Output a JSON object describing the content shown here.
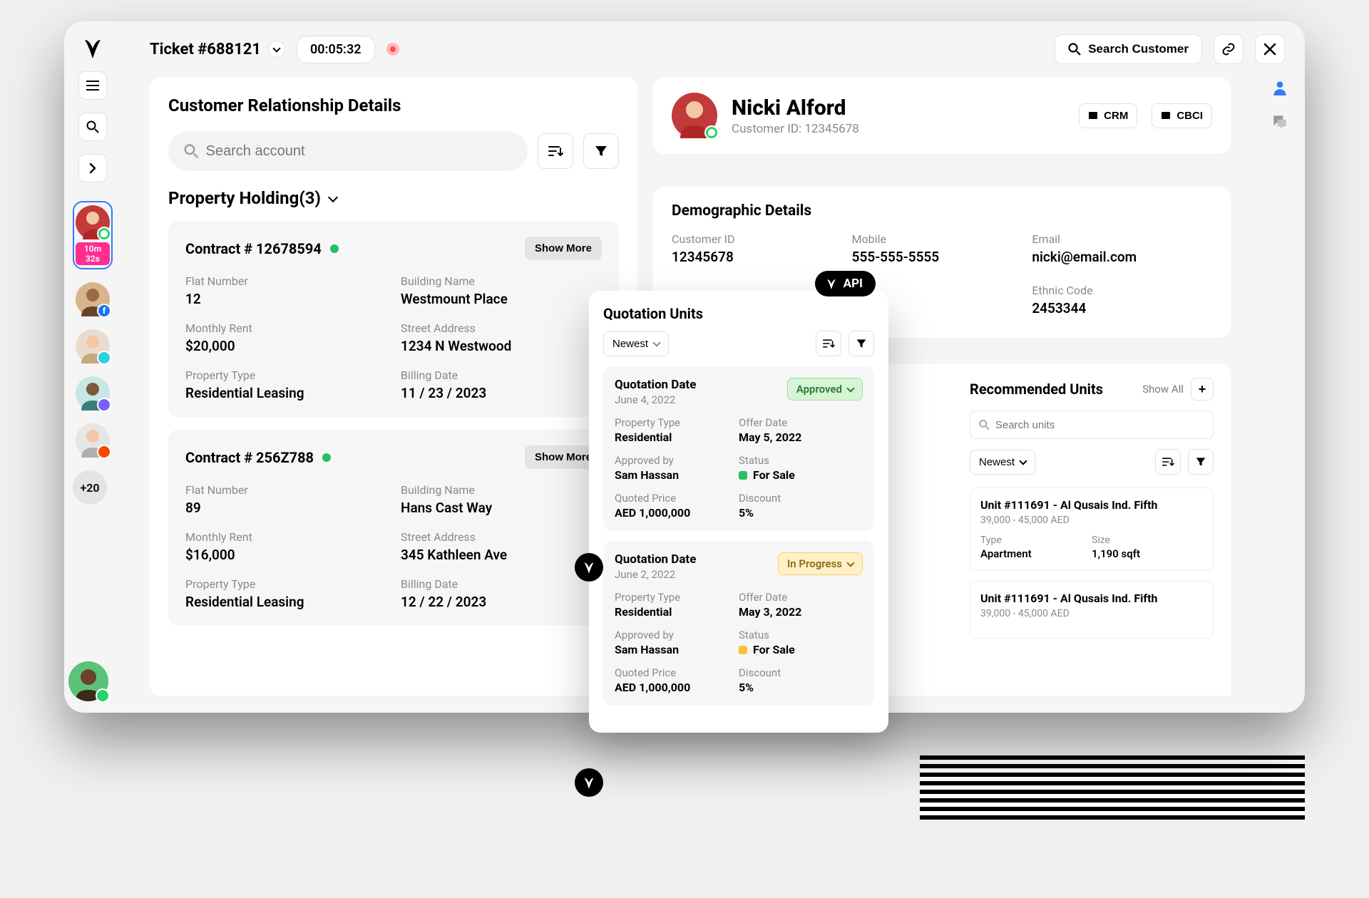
{
  "topbar": {
    "ticket_label": "Ticket #688121",
    "timer": "00:05:32",
    "search_customer_label": "Search Customer"
  },
  "sidebar": {
    "active_timer": "10m 32s",
    "more_label": "+20"
  },
  "left_panel": {
    "title": "Customer Relationship Details",
    "search_placeholder": "Search account",
    "holding_header": "Property Holding(3)",
    "show_more_label": "Show More",
    "labels": {
      "flat": "Flat Number",
      "building": "Building Name",
      "rent": "Monthly Rent",
      "street": "Street Address",
      "ptype": "Property Type",
      "billing": "Billing Date"
    },
    "contracts": [
      {
        "title": "Contract # 12678594",
        "flat": "12",
        "building": "Westmount Place",
        "rent": "$20,000",
        "street": "1234 N Westwood",
        "ptype": "Residential Leasing",
        "billing": "11 / 23 / 2023"
      },
      {
        "title": "Contract # 256Z788",
        "flat": "89",
        "building": "Hans Cast Way",
        "rent": "$16,000",
        "street": "345 Kathleen Ave",
        "ptype": "Residential Leasing",
        "billing": "12 / 22 / 2023"
      }
    ]
  },
  "customer": {
    "name": "Nicki Alford",
    "id_label": "Customer ID: 12345678",
    "crm_label": "CRM",
    "cbci_label": "CBCI"
  },
  "demo": {
    "title": "Demographic Details",
    "labels": {
      "cid": "Customer ID",
      "mobile": "Mobile",
      "email": "Email",
      "ethnic": "Ethnic Code"
    },
    "values": {
      "cid": "12345678",
      "mobile": "555-555-5555",
      "email": "nicki@email.com",
      "ethnic": "2453344"
    }
  },
  "quote": {
    "title": "Quotation Units",
    "api_label": "API",
    "newest_label": "Newest",
    "labels": {
      "qdate": "Quotation Date",
      "ptype": "Property Type",
      "offer": "Offer Date",
      "approved_by": "Approved by",
      "status": "Status",
      "price": "Quoted Price",
      "discount": "Discount",
      "forsale": "For Sale"
    },
    "items": [
      {
        "date": "June 4, 2022",
        "status_label": "Approved",
        "status_kind": "approved",
        "ptype": "Residential",
        "offer": "May 5, 2022",
        "approved_by": "Sam Hassan",
        "forsale_color": "#23c162",
        "price": "AED 1,000,000",
        "discount": "5%"
      },
      {
        "date": "June 2, 2022",
        "status_label": "In Progress",
        "status_kind": "progress",
        "ptype": "Residential",
        "offer": "May 3, 2022",
        "approved_by": "Sam Hassan",
        "forsale_color": "#f4c23b",
        "price": "AED 1,000,000",
        "discount": "5%"
      }
    ]
  },
  "recommended": {
    "title": "Recommended Units",
    "show_all": "Show All",
    "search_placeholder": "Search units",
    "newest_label": "Newest",
    "labels": {
      "type": "Type",
      "size": "Size"
    },
    "units": [
      {
        "title": "Unit #111691 - Al Qusais Ind. Fifth",
        "price": "39,000 - 45,000 AED",
        "type": "Apartment",
        "size": "1,190 sqft"
      },
      {
        "title": "Unit #111691 - Al Qusais Ind. Fifth",
        "price": "39,000 - 45,000 AED"
      }
    ]
  }
}
